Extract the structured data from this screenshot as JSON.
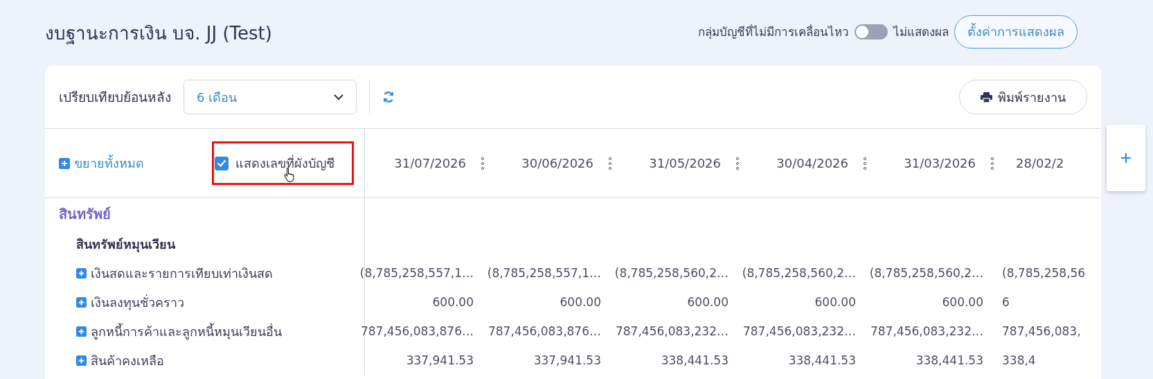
{
  "page": {
    "title": "งบฐานะการเงิน บจ. JJ (Test)"
  },
  "header_controls": {
    "toggle_label": "กลุ่มบัญชีที่ไม่มีการเคลื่อนไหว",
    "toggle_on": false,
    "toggle_state_text": "ไม่แสดงผล",
    "settings_button": "ตั้งค่าการแสดงผล"
  },
  "toolbar": {
    "compare_label": "เปรียบเทียบย้อนหลัง",
    "period_select": "6 เดือน",
    "print_button": "พิมพ์รายงาน"
  },
  "table": {
    "expand_all": "ขยายทั้งหมด",
    "show_account_numbers": {
      "label": "แสดงเลขที่ผังบัญชี",
      "checked": true
    },
    "columns": [
      "31/07/2026",
      "30/06/2026",
      "31/05/2026",
      "30/04/2026",
      "31/03/2026",
      "28/02/2"
    ],
    "rows": [
      {
        "kind": "group",
        "label": "สินทรัพย์"
      },
      {
        "kind": "subgroup",
        "label": "สินทรัพย์หมุนเวียน"
      },
      {
        "kind": "account",
        "label": "เงินสดและรายการเทียบเท่าเงินสด",
        "values": [
          "(8,785,258,557,1…",
          "(8,785,258,557,1…",
          "(8,785,258,560,2…",
          "(8,785,258,560,2…",
          "(8,785,258,560,2…",
          "(8,785,258,56"
        ]
      },
      {
        "kind": "account",
        "label": "เงินลงทุนชั่วคราว",
        "values": [
          "600.00",
          "600.00",
          "600.00",
          "600.00",
          "600.00",
          "6"
        ]
      },
      {
        "kind": "account",
        "label": "ลูกหนี้การค้าและลูกหนี้หมุนเวียนอื่น",
        "values": [
          "787,456,083,876…",
          "787,456,083,876…",
          "787,456,083,232…",
          "787,456,083,232…",
          "787,456,083,232…",
          "787,456,083,"
        ]
      },
      {
        "kind": "account",
        "label": "สินค้าคงเหลือ",
        "values": [
          "337,941.53",
          "337,941.53",
          "338,441.53",
          "338,441.53",
          "338,441.53",
          "338,4"
        ]
      }
    ]
  }
}
